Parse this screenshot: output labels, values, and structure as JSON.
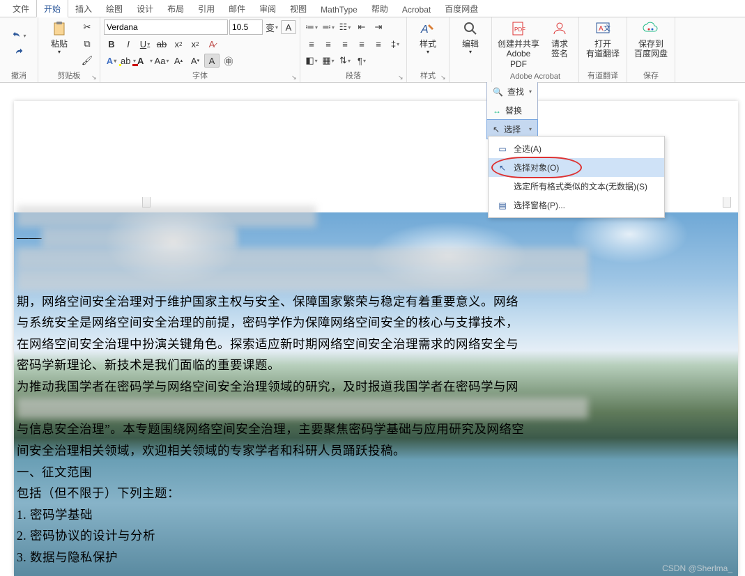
{
  "tabs": {
    "items": [
      "文件",
      "开始",
      "插入",
      "绘图",
      "设计",
      "布局",
      "引用",
      "邮件",
      "审阅",
      "视图",
      "MathType",
      "帮助",
      "Acrobat",
      "百度网盘"
    ],
    "active": 1
  },
  "ribbon": {
    "undo": {
      "label": "撤消"
    },
    "clipboard": {
      "label": "剪贴板",
      "paste": "粘贴"
    },
    "font": {
      "label": "字体",
      "name": "Verdana",
      "size": "10.5"
    },
    "paragraph": {
      "label": "段落"
    },
    "styles": {
      "label": "样式",
      "btn": "样式"
    },
    "editing": {
      "label": "编辑",
      "btn": "编辑"
    },
    "acrobat": {
      "label": "Adobe Acrobat",
      "create": "创建并共享\nAdobe PDF",
      "sign": "请求\n签名"
    },
    "youdao": {
      "label": "有道翻译",
      "open": "打开\n有道翻译"
    },
    "baidu": {
      "label": "保存",
      "save": "保存到\n百度网盘"
    }
  },
  "editpane": {
    "find": "查找",
    "replace": "替换",
    "select": "选择"
  },
  "selectmenu": {
    "all": "全选(A)",
    "objects": "选择对象(O)",
    "similar": "选定所有格式类似的文本(无数据)(S)",
    "pane": "选择窗格(P)..."
  },
  "doc": {
    "lines": [
      "",
      "——",
      "",
      "",
      "期，网络空间安全治理对于维护国家主权与安全、保障国家繁荣与稳定有着重要意义。网络",
      "与系统安全是网络空间安全治理的前提，密码学作为保障网络空间安全的核心与支撑技术，",
      "在网络空间安全治理中扮演关键角色。探索适应新时期网络空间安全治理需求的网络安全与",
      "密码学新理论、新技术是我们面临的重要课题。",
      "为推动我国学者在密码学与网络空间安全治理领域的研究，及时报道我国学者在密码学与网",
      "",
      "与信息安全治理”。本专题围绕网络空间安全治理，主要聚焦密码学基础与应用研究及网络空",
      "间安全治理相关领域，欢迎相关领域的专家学者和科研人员踊跃投稿。",
      "一、征文范围",
      "包括（但不限于）下列主题：",
      "1.  密码学基础",
      "2.  密码协议的设计与分析",
      "3.  数据与隐私保护"
    ]
  },
  "watermark": "CSDN @Sherlma_"
}
